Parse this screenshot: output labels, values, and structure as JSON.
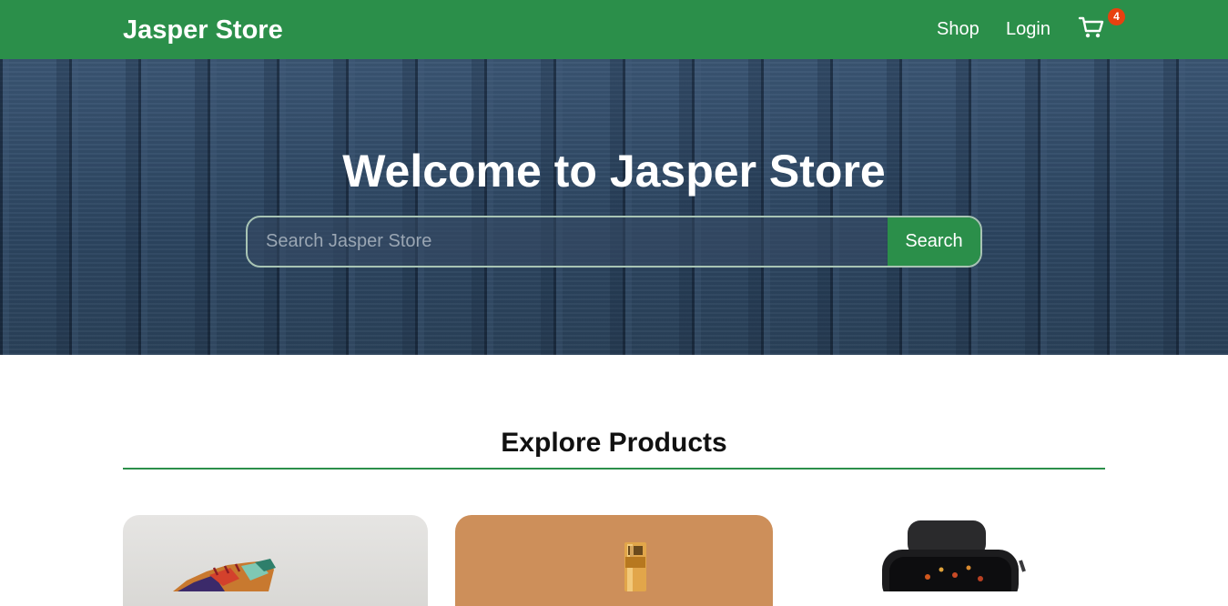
{
  "navbar": {
    "brand": "Jasper Store",
    "links": [
      "Shop",
      "Login"
    ],
    "cart_icon": "cart-icon",
    "cart_count": "4"
  },
  "hero": {
    "title": "Welcome to Jasper Store",
    "search_placeholder": "Search Jasper Store",
    "search_value": "",
    "search_button": "Search"
  },
  "products": {
    "title": "Explore Products",
    "items": [
      {
        "image": "sneaker-image"
      },
      {
        "image": "perfume-bottle-image"
      },
      {
        "image": "smartwatch-image"
      }
    ]
  },
  "colors": {
    "brand_green": "#2b8f4a",
    "badge": "#e8410f",
    "hero_wood": "#2f4863"
  }
}
